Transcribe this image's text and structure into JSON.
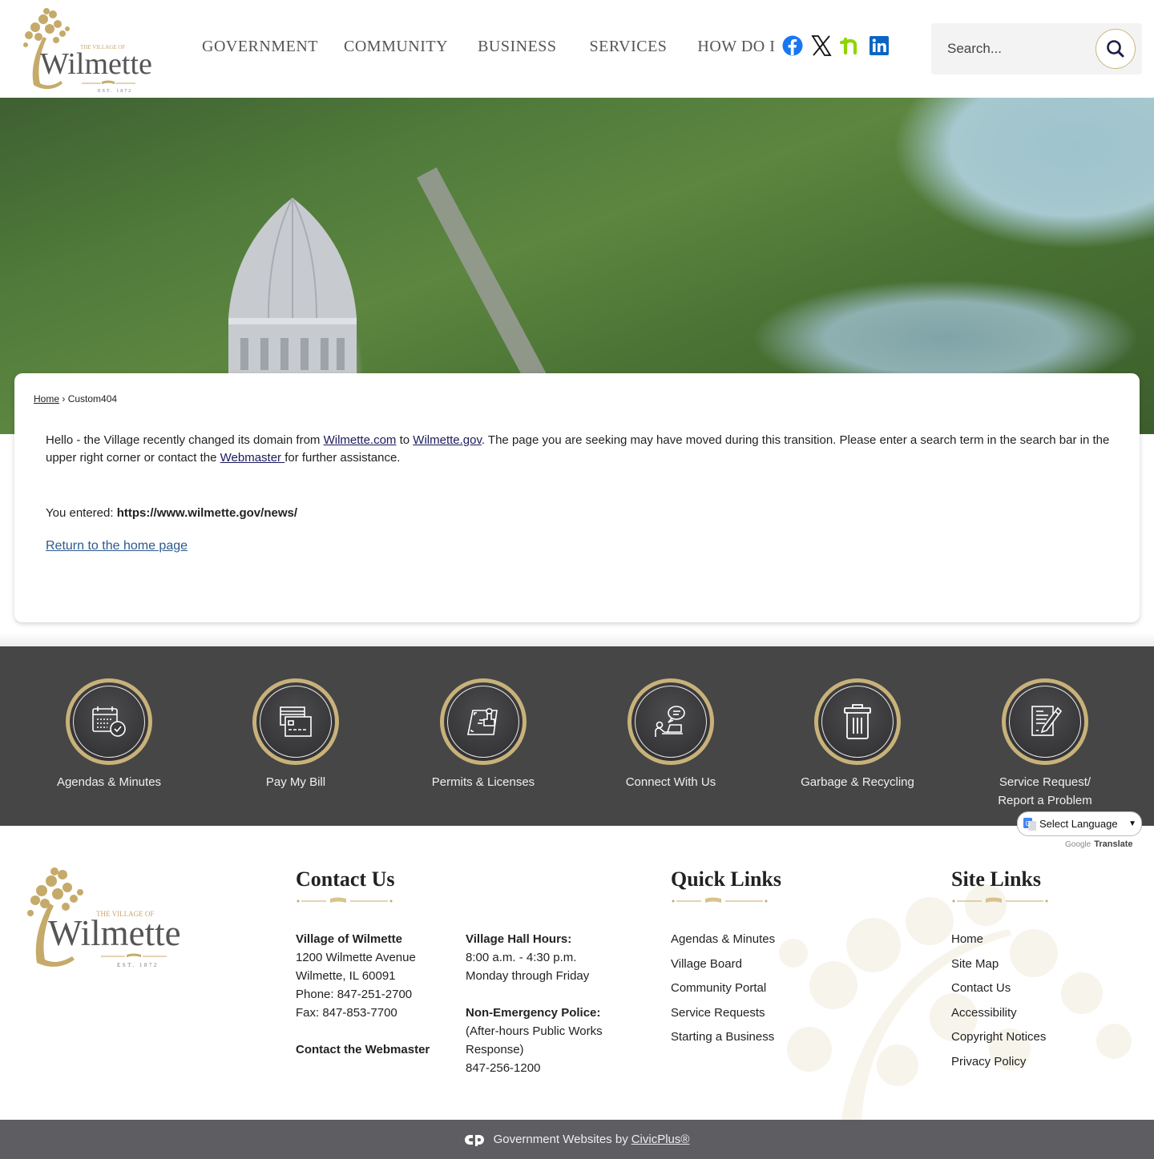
{
  "header": {
    "logo_alt": "The Village of Wilmette Est. 1872",
    "logo_small": "THE VILLAGE OF",
    "logo_name": "Wilmette",
    "logo_est": "EST. 1872",
    "nav": [
      {
        "label": "GOVERNMENT"
      },
      {
        "label": "COMMUNITY"
      },
      {
        "label": "BUSINESS"
      },
      {
        "label": "SERVICES"
      },
      {
        "label": "HOW DO I"
      }
    ],
    "social": [
      {
        "name": "facebook",
        "icon": "facebook-icon",
        "color": "#1877f2"
      },
      {
        "name": "x",
        "icon": "x-icon",
        "color": "#111111"
      },
      {
        "name": "nextdoor",
        "icon": "nextdoor-icon",
        "color": "#8ed500"
      },
      {
        "name": "linkedin",
        "icon": "linkedin-icon",
        "color": "#0a66c2"
      }
    ],
    "search": {
      "placeholder": "Search...",
      "value": "",
      "icon": "search-icon"
    }
  },
  "breadcrumb": {
    "home": "Home",
    "separator": "›",
    "current": "Custom404"
  },
  "message": {
    "part1": "Hello - the Village recently changed its domain from ",
    "link1": "Wilmette.com",
    "part2": " to ",
    "link2": "Wilmette.gov",
    "part3": ". The page you are seeking may have moved during this transition. Please enter a search term in the search bar in the upper right corner or contact the ",
    "link3": "Webmaster ",
    "part4": "for further assistance.",
    "entered_label": "You entered: ",
    "entered_url": "https://www.wilmette.gov/news/",
    "return_link": "Return to the home page"
  },
  "quick_buttons": [
    {
      "label": "Agendas & Minutes",
      "icon": "calendar-check-icon"
    },
    {
      "label": "Pay My Bill",
      "icon": "credit-card-icon"
    },
    {
      "label": "Permits & Licenses",
      "icon": "stamp-icon"
    },
    {
      "label": "Connect With Us",
      "icon": "person-chat-icon"
    },
    {
      "label": "Garbage & Recycling",
      "icon": "trash-can-icon"
    },
    {
      "label": "Service Request/",
      "label2": "Report a Problem",
      "icon": "document-pen-icon"
    }
  ],
  "translate": {
    "select_label": "Select Language",
    "powered_by": "Google",
    "translate_label": "Translate"
  },
  "footer": {
    "contact": {
      "title": "Contact Us",
      "org": "Village of Wilmette",
      "address1": "1200 Wilmette Avenue",
      "address2": "Wilmette, IL 60091",
      "phone": "Phone: 847-251-2700",
      "fax": "Fax: 847-853-7700",
      "webmaster": "Contact the Webmaster",
      "hours_title": "Village Hall Hours:",
      "hours1": "8:00 a.m. - 4:30 p.m.",
      "hours2": "Monday through Friday",
      "police_title": "Non-Emergency Police:",
      "police1": "(After-hours Public Works",
      "police2": "Response)",
      "police_phone": "847-256-1200"
    },
    "quick_links": {
      "title": "Quick Links",
      "items": [
        "Agendas & Minutes",
        "Village Board",
        "Community Portal",
        "Service Requests",
        "Starting a Business"
      ]
    },
    "site_links": {
      "title": "Site Links",
      "items": [
        "Home",
        "Site Map",
        "Contact Us",
        "Accessibility",
        "Copyright Notices",
        "Privacy Policy"
      ]
    }
  },
  "bottom_bar": {
    "text": "Government Websites by",
    "link": "CivicPlus®"
  },
  "colors": {
    "gold": "#c8b27a",
    "band": "#464646",
    "bottom_bar": "#5e5e62",
    "link": "#2c5a8c"
  }
}
